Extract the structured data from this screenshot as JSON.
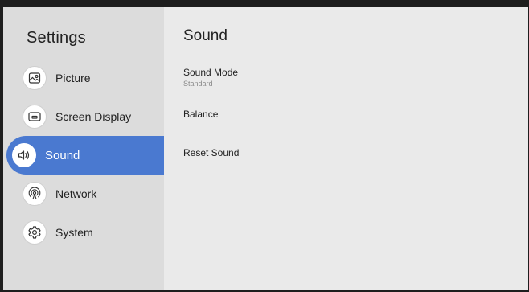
{
  "sidebar": {
    "title": "Settings",
    "items": [
      {
        "label": "Picture",
        "icon": "picture-icon"
      },
      {
        "label": "Screen Display",
        "icon": "screen-display-icon"
      },
      {
        "label": "Sound",
        "icon": "speaker-icon",
        "selected": true
      },
      {
        "label": "Network",
        "icon": "network-icon"
      },
      {
        "label": "System",
        "icon": "gear-icon"
      }
    ]
  },
  "main": {
    "title": "Sound",
    "options": [
      {
        "label": "Sound Mode",
        "value": "Standard"
      },
      {
        "label": "Balance"
      },
      {
        "label": "Reset Sound"
      }
    ]
  },
  "colors": {
    "selection": "#4a79d0",
    "sidebar_bg": "#dcdcdc",
    "content_bg": "#eaeaea"
  }
}
